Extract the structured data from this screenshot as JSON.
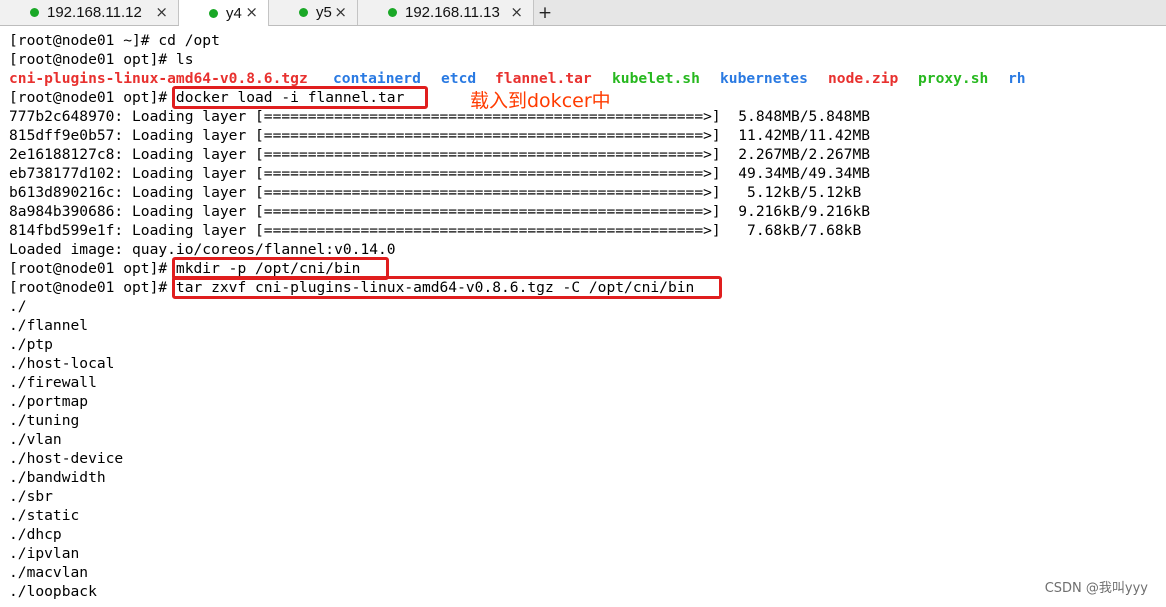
{
  "tabs": [
    {
      "label": "192.168.11.12",
      "dot_color": "#1aa827",
      "active": false
    },
    {
      "label": "y4",
      "dot_color": "#1aa827",
      "active": true
    },
    {
      "label": "y5",
      "dot_color": "#1aa827",
      "active": false
    },
    {
      "label": "192.168.11.13",
      "dot_color": "#1aa827",
      "active": false
    }
  ],
  "close_glyph": "×",
  "add_tab_glyph": "+",
  "terminal": {
    "lines": [
      "[root@node01 ~]# cd /opt",
      "[root@node01 opt]# ls",
      "",
      "[root@node01 opt]# docker load -i flannel.tar",
      "777b2c648970: Loading layer [==================================================>]  5.848MB/5.848MB",
      "815dff9e0b57: Loading layer [==================================================>]  11.42MB/11.42MB",
      "2e16188127c8: Loading layer [==================================================>]  2.267MB/2.267MB",
      "eb738177d102: Loading layer [==================================================>]  49.34MB/49.34MB",
      "b613d890216c: Loading layer [==================================================>]   5.12kB/5.12kB",
      "8a984b390686: Loading layer [==================================================>]  9.216kB/9.216kB",
      "814fbd599e1f: Loading layer [==================================================>]   7.68kB/7.68kB",
      "Loaded image: quay.io/coreos/flannel:v0.14.0",
      "[root@node01 opt]# mkdir -p /opt/cni/bin",
      "[root@node01 opt]# tar zxvf cni-plugins-linux-amd64-v0.8.6.tgz -C /opt/cni/bin",
      "./",
      "./flannel",
      "./ptp",
      "./host-local",
      "./firewall",
      "./portmap",
      "./tuning",
      "./vlan",
      "./host-device",
      "./bandwidth",
      "./sbr",
      "./static",
      "./dhcp",
      "./ipvlan",
      "./macvlan",
      "./loopback"
    ],
    "ls_output": [
      {
        "name": "cni-plugins-linux-amd64-v0.8.6.tgz",
        "color": "#e8312f"
      },
      {
        "name": "containerd",
        "color": "#2a7ae2"
      },
      {
        "name": "etcd",
        "color": "#2a7ae2"
      },
      {
        "name": "flannel.tar",
        "color": "#e8312f"
      },
      {
        "name": "kubelet.sh",
        "color": "#27b81f"
      },
      {
        "name": "kubernetes",
        "color": "#2a7ae2"
      },
      {
        "name": "node.zip",
        "color": "#e8312f"
      },
      {
        "name": "proxy.sh",
        "color": "#27b81f"
      },
      {
        "name": "rh",
        "color": "#2a7ae2"
      }
    ]
  },
  "annotation": "载入到dokcer中",
  "highlight_color": "#e01e1e",
  "watermark": "CSDN @我叫yyy"
}
